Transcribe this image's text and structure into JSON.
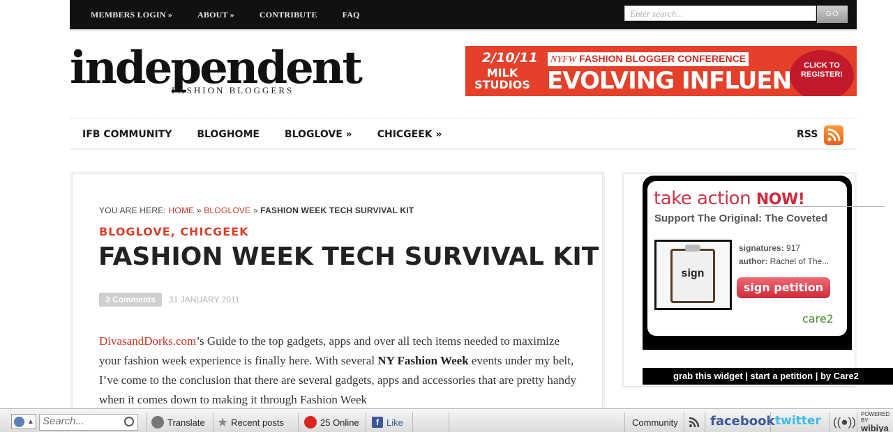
{
  "topbar": {
    "nav": [
      "MEMBERS LOGIN »",
      "ABOUT »",
      "CONTRIBUTE",
      "FAQ"
    ],
    "search_placeholder": "Enter search...",
    "go_label": "GO"
  },
  "logo": {
    "word": "independent",
    "sub": "FASHION BLOGGERS"
  },
  "banner": {
    "date": "2/10/11",
    "venue": "MILK STUDIOS",
    "tagline_prefix": "NYFW",
    "tagline": "FASHION BLOGGER CONFERENCE",
    "headline": "EVOLVING INFLUENCE",
    "cta": "CLICK TO REGISTER!"
  },
  "mainnav": {
    "items": [
      "IFB COMMUNITY",
      "BLOGHOME",
      "BLOGLOVE »",
      "CHICGEEK »"
    ],
    "rss": "RSS"
  },
  "article": {
    "crumb_prefix": "YOU ARE HERE:",
    "crumb_home": "HOME",
    "crumb_sep": "»",
    "crumb_cat": "BLOGLOVE",
    "crumb_current": "FASHION WEEK TECH SURVIVAL KIT",
    "categories": "BLOGLOVE, CHICGEEK",
    "title": "FASHION WEEK TECH SURVIVAL KIT",
    "comments": "3 Comments",
    "date": "31 JANUARY 2011",
    "body_link": "DivasandDorks.com",
    "body_1": "’s Guide to the top gadgets, apps and over all tech items needed to maximize your fashion week experience is finally here.  With several ",
    "body_bold": "NY Fashion Week",
    "body_2": " events under my belt, I’ve come to the conclusion that there are several gadgets, apps and accessories that are pretty handy when it comes down to making it through Fashion Week"
  },
  "widget": {
    "take_action": "take action",
    "now": "NOW!",
    "support": "Support The Original: The Coveted",
    "clip_label": "sign",
    "signatures_label": "signatures:",
    "signatures": "917",
    "author_label": "author:",
    "author": "Rachel of The...",
    "sign_button": "sign petition",
    "care2": "care",
    "care2_num": "2",
    "footer": "grab this widget | start a petition | by Care2"
  },
  "toolbar": {
    "search_placeholder": "Search...",
    "translate": "Translate",
    "recent": "Recent posts",
    "online": "25 Online",
    "like": "Like",
    "community": "Community",
    "facebook": "facebook",
    "twitter": "twitter",
    "powered": "POWERED BY",
    "wibiya": "wibiya"
  },
  "colors": {
    "accent_red": "#cc3322",
    "topbar_bg": "#111111",
    "banner_bg": "#e4402a",
    "rss_orange": "#f0782a",
    "facebook_blue": "#3b5998",
    "twitter_blue": "#3bbde6"
  }
}
